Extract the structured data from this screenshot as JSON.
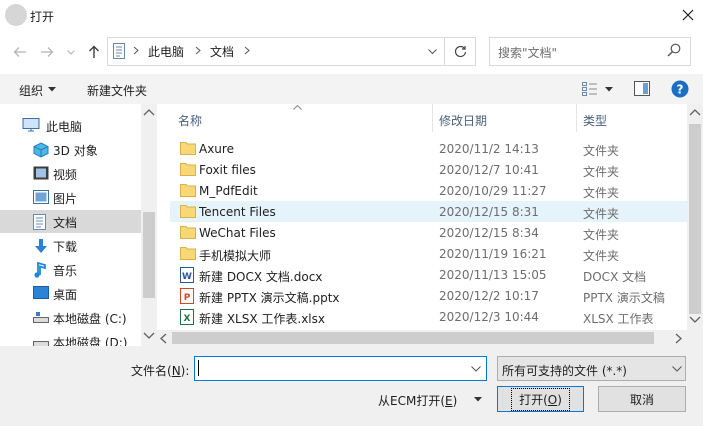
{
  "window": {
    "title": "打开",
    "close_glyph": "✕"
  },
  "nav": {
    "back_icon": "back-arrow-icon",
    "forward_icon": "forward-arrow-icon",
    "recent_icon": "chevron-down-icon",
    "up_icon": "up-arrow-icon",
    "breadcrumb": [
      "此电脑",
      "文档"
    ],
    "search_placeholder": "搜索\"文档\""
  },
  "toolbar": {
    "organize": "组织",
    "new_folder": "新建文件夹"
  },
  "sidebar": {
    "items": [
      {
        "label": "此电脑",
        "icon": "computer-icon"
      },
      {
        "label": "3D 对象",
        "icon": "3d-objects-icon"
      },
      {
        "label": "视频",
        "icon": "video-icon"
      },
      {
        "label": "图片",
        "icon": "picture-icon"
      },
      {
        "label": "文档",
        "icon": "document-icon",
        "selected": true
      },
      {
        "label": "下载",
        "icon": "download-icon"
      },
      {
        "label": "音乐",
        "icon": "music-icon"
      },
      {
        "label": "桌面",
        "icon": "desktop-icon"
      },
      {
        "label": "本地磁盘 (C:)",
        "icon": "drive-icon"
      },
      {
        "label": "本地磁盘 (D:)",
        "icon": "drive-icon"
      }
    ]
  },
  "columns": {
    "name": "名称",
    "date": "修改日期",
    "type": "类型"
  },
  "files": [
    {
      "name": "Axure",
      "date": "2020/11/2 14:13",
      "type": "文件夹",
      "icon": "folder-icon"
    },
    {
      "name": "Foxit files",
      "date": "2020/12/7 10:41",
      "type": "文件夹",
      "icon": "folder-icon"
    },
    {
      "name": "M_PdfEdit",
      "date": "2020/10/29 11:27",
      "type": "文件夹",
      "icon": "folder-icon"
    },
    {
      "name": "Tencent Files",
      "date": "2020/12/15 8:31",
      "type": "文件夹",
      "icon": "folder-icon",
      "hover": true
    },
    {
      "name": "WeChat Files",
      "date": "2020/12/15 8:34",
      "type": "文件夹",
      "icon": "folder-icon"
    },
    {
      "name": "手机模拟大师",
      "date": "2020/11/19 16:21",
      "type": "文件夹",
      "icon": "folder-icon"
    },
    {
      "name": "新建 DOCX 文档.docx",
      "date": "2020/11/13 15:05",
      "type": "DOCX 文档",
      "icon": "word-doc-icon"
    },
    {
      "name": "新建 PPTX 演示文稿.pptx",
      "date": "2020/12/2 10:17",
      "type": "PPTX 演示文稿",
      "icon": "powerpoint-doc-icon"
    },
    {
      "name": "新建 XLSX 工作表.xlsx",
      "date": "2020/12/3 10:44",
      "type": "XLSX 工作表",
      "icon": "excel-doc-icon"
    }
  ],
  "bottom": {
    "filename_label": "文件名(N):",
    "filename_value": "",
    "filetype": "所有可支持的文件 (*.*)",
    "ecm_label": "从ECM打开(E)",
    "open_label": "打开(O)",
    "cancel_label": "取消"
  },
  "colors": {
    "accent": "#0078d7",
    "folder": "#f8d775",
    "selected_bg": "#d9d9d9",
    "hover_bg": "#e5f3fb"
  }
}
